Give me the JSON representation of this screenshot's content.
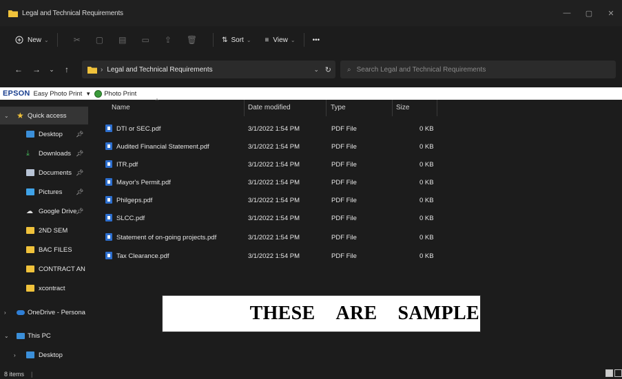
{
  "window": {
    "title": "Legal and Technical Requirements",
    "controls": {
      "minimize": "—",
      "maximize": "▢",
      "close": "✕"
    }
  },
  "toolbar": {
    "new_label": "New",
    "sort_label": "Sort",
    "view_label": "View",
    "more_label": "•••"
  },
  "address": {
    "breadcrumb": "Legal and Technical Requirements",
    "search_placeholder": "Search Legal and Technical Requirements"
  },
  "epson": {
    "brand": "EPSON",
    "easy_photo_print": "Easy Photo Print",
    "photo_print": "Photo Print"
  },
  "nav": {
    "quick_access": "Quick access",
    "items": [
      {
        "label": "Desktop",
        "icon": "desktop-icon",
        "pinned": true
      },
      {
        "label": "Downloads",
        "icon": "download-icon",
        "pinned": true
      },
      {
        "label": "Documents",
        "icon": "documents-icon",
        "pinned": true
      },
      {
        "label": "Pictures",
        "icon": "pictures-icon",
        "pinned": true
      },
      {
        "label": "Google Drive",
        "icon": "google-drive-icon",
        "pinned": true
      },
      {
        "label": "2ND SEM",
        "icon": "folder-icon",
        "pinned": false
      },
      {
        "label": "BAC FILES",
        "icon": "folder-icon",
        "pinned": false
      },
      {
        "label": "CONTRACT AND",
        "icon": "folder-icon",
        "pinned": false
      },
      {
        "label": "xcontract",
        "icon": "folder-icon",
        "pinned": false
      }
    ],
    "onedrive": "OneDrive - Personal",
    "this_pc": "This PC",
    "this_pc_desktop": "Desktop"
  },
  "columns": {
    "name": "Name",
    "date": "Date modified",
    "type": "Type",
    "size": "Size"
  },
  "files": [
    {
      "name": "DTI or SEC.pdf",
      "date": "3/1/2022 1:54 PM",
      "type": "PDF File",
      "size": "0 KB"
    },
    {
      "name": "Audited Financial Statement.pdf",
      "date": "3/1/2022 1:54 PM",
      "type": "PDF File",
      "size": "0 KB"
    },
    {
      "name": "ITR.pdf",
      "date": "3/1/2022 1:54 PM",
      "type": "PDF File",
      "size": "0 KB"
    },
    {
      "name": "Mayor's Permit.pdf",
      "date": "3/1/2022 1:54 PM",
      "type": "PDF File",
      "size": "0 KB"
    },
    {
      "name": "Philgeps.pdf",
      "date": "3/1/2022 1:54 PM",
      "type": "PDF File",
      "size": "0 KB"
    },
    {
      "name": "SLCC.pdf",
      "date": "3/1/2022 1:54 PM",
      "type": "PDF File",
      "size": "0 KB"
    },
    {
      "name": "Statement of on-going projects.pdf",
      "date": "3/1/2022 1:54 PM",
      "type": "PDF File",
      "size": "0 KB"
    },
    {
      "name": "Tax Clearance.pdf",
      "date": "3/1/2022 1:54 PM",
      "type": "PDF File",
      "size": "0 KB"
    }
  ],
  "overlay": {
    "w1": "THESE",
    "w2": "ARE",
    "w3": "SAMPLE"
  },
  "status": {
    "count": "8 items",
    "separator": "|"
  },
  "colors": {
    "background": "#1c1c1c",
    "folder": "#f0c23b",
    "accent": "#3b8fd9",
    "selected": "#353535"
  }
}
